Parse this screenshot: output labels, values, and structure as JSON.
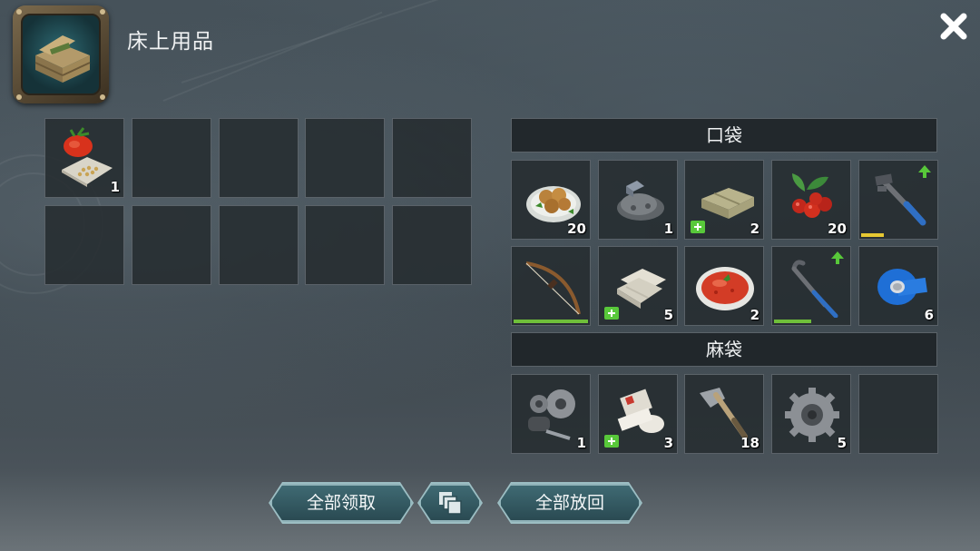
{
  "header": {
    "title": "床上用品",
    "close_icon": "close-icon",
    "container_icon": "crate-container-icon"
  },
  "container_grid": {
    "slots": [
      {
        "item": "tomato-seeds-icon",
        "count": "1"
      },
      {
        "item": null,
        "count": ""
      },
      {
        "item": null,
        "count": ""
      },
      {
        "item": null,
        "count": ""
      },
      {
        "item": null,
        "count": ""
      },
      {
        "item": null,
        "count": ""
      },
      {
        "item": null,
        "count": ""
      },
      {
        "item": null,
        "count": ""
      },
      {
        "item": null,
        "count": ""
      },
      {
        "item": null,
        "count": ""
      }
    ]
  },
  "inventory": {
    "pockets_title": "口袋",
    "pockets": [
      {
        "item": "mushroom-plate-icon",
        "count": "20",
        "medical": false,
        "upgrade": false,
        "durability": null
      },
      {
        "item": "ore-pile-icon",
        "count": "1",
        "medical": false,
        "upgrade": false,
        "durability": null
      },
      {
        "item": "bandage-stack-icon",
        "count": "2",
        "medical": true,
        "upgrade": false,
        "durability": null
      },
      {
        "item": "rosehip-berries-icon",
        "count": "20",
        "medical": false,
        "upgrade": false,
        "durability": null
      },
      {
        "item": "pipe-wrench-icon",
        "count": "",
        "medical": false,
        "upgrade": true,
        "durability": {
          "value": 0.3,
          "color": "#e7c832"
        }
      },
      {
        "item": "bow-icon",
        "count": "",
        "medical": false,
        "upgrade": false,
        "durability": {
          "value": 1.0,
          "color": "#6fbf3a"
        }
      },
      {
        "item": "cloth-bandages-icon",
        "count": "5",
        "medical": true,
        "upgrade": false,
        "durability": null
      },
      {
        "item": "tomato-soup-icon",
        "count": "2",
        "medical": false,
        "upgrade": false,
        "durability": null
      },
      {
        "item": "crowbar-icon",
        "count": "",
        "medical": false,
        "upgrade": true,
        "durability": {
          "value": 0.5,
          "color": "#6fbf3a"
        }
      },
      {
        "item": "blue-tape-icon",
        "count": "6",
        "medical": false,
        "upgrade": false,
        "durability": null
      }
    ],
    "sack_title": "麻袋",
    "sack": [
      {
        "item": "gears-parts-icon",
        "count": "1",
        "medical": false
      },
      {
        "item": "gauze-bandage-icon",
        "count": "3",
        "medical": true
      },
      {
        "item": "hatchet-icon",
        "count": "18",
        "medical": false
      },
      {
        "item": "cog-wheel-icon",
        "count": "5",
        "medical": false
      },
      {
        "item": null,
        "count": "",
        "medical": false
      }
    ]
  },
  "actions": {
    "take_all": "全部领取",
    "sort_icon": "stack-sort-icon",
    "put_back_all": "全部放回"
  }
}
